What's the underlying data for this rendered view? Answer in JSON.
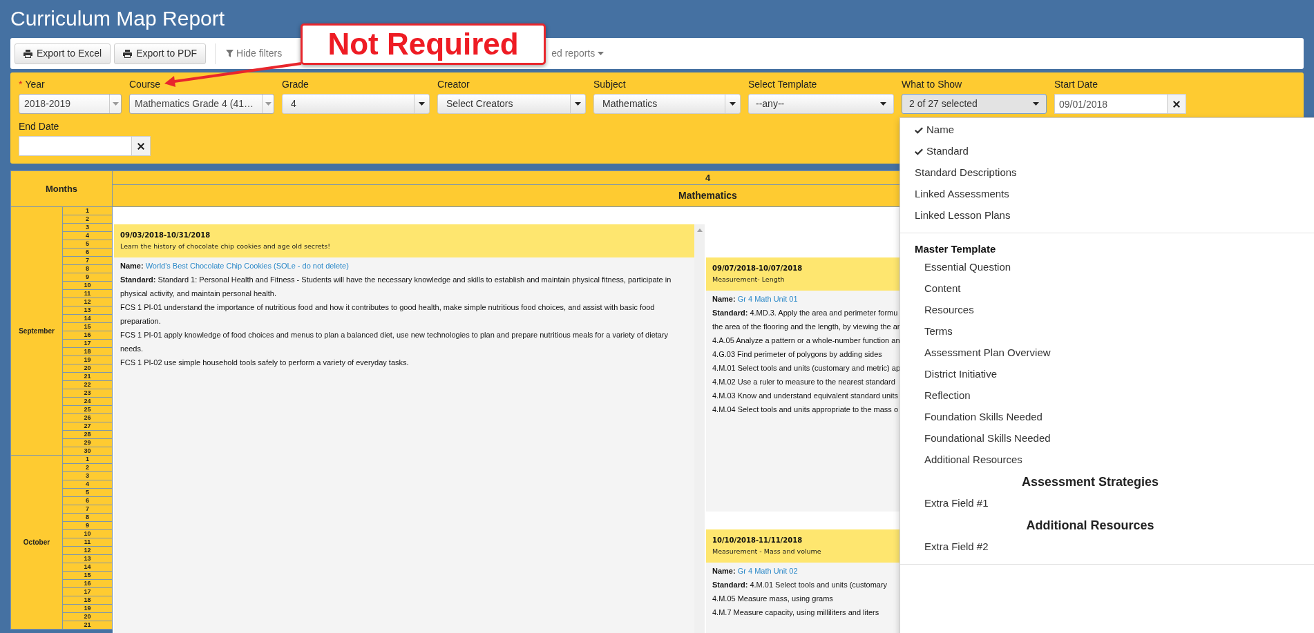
{
  "title": "Curriculum Map Report",
  "toolbar": {
    "buttons": [
      {
        "label": "Export to Excel"
      },
      {
        "label": "Export to PDF"
      }
    ],
    "links": [
      {
        "label": "Hide filters",
        "kind": "filter"
      },
      {
        "label": "ed reports",
        "kind": "menu"
      }
    ]
  },
  "annotation": {
    "text": "Not Required"
  },
  "filters": [
    {
      "label": "Year",
      "required_mark": "*",
      "kind": "combo",
      "value": "2018-2019"
    },
    {
      "label": "Course",
      "kind": "combo",
      "value": "Mathematics Grade 4 (41…"
    },
    {
      "label": "Grade",
      "kind": "select",
      "value": "4"
    },
    {
      "label": "Creator",
      "kind": "select",
      "value": "Select Creators"
    },
    {
      "label": "Subject",
      "kind": "select",
      "value": "Mathematics"
    },
    {
      "label": "Select Template",
      "kind": "plain",
      "value": "--any--",
      "open": false
    },
    {
      "label": "What to Show",
      "kind": "plain",
      "value": "2 of 27 selected",
      "open": true
    },
    {
      "label": "Start Date",
      "kind": "date",
      "value": "09/01/2018"
    },
    {
      "label": "End Date",
      "kind": "date"
    }
  ],
  "table": {
    "months_header": "Months",
    "grade_header": "4",
    "subject_header": "Mathematics",
    "months": [
      {
        "name": "September",
        "days": [
          "1",
          "2",
          "3",
          "4",
          "5",
          "6",
          "7",
          "8",
          "9",
          "10",
          "11",
          "12",
          "13",
          "14",
          "15",
          "16",
          "17",
          "18",
          "19",
          "20",
          "21",
          "22",
          "23",
          "24",
          "25",
          "26",
          "27",
          "28",
          "29",
          "30"
        ]
      },
      {
        "name": "October",
        "days": [
          "1",
          "2",
          "3",
          "4",
          "5",
          "6",
          "7",
          "8",
          "9",
          "10",
          "11",
          "12",
          "13",
          "14",
          "15",
          "16",
          "17",
          "18",
          "19",
          "20",
          "21"
        ]
      }
    ],
    "columns": [
      {
        "cards": [
          {
            "dates": "09/03/2018-10/31/2018",
            "description": "Learn the history of chocolate chip cookies and age old secrets!",
            "name_label": "Name:",
            "name": "World's Best Chocolate Chip Cookies (SOLe - do not delete)",
            "standard": "**Standard:** Standard 1: Personal Health and Fitness - Students will have the necessary knowledge and skills to establish and maintain physical fitness, participate in physical activity, and maintain personal health.",
            "lines": [
              "FCS 1 PI-01 understand the importance of nutritious food and how it contributes to good health, make simple nutritious food choices, and assist with basic food preparation.",
              "FCS 1 PI-01 apply knowledge of food choices and menus to plan a balanced diet, use new technologies to plan and prepare nutritious meals for a variety of dietary needs.",
              "FCS 1 PI-02 use simple household tools safely to perform a variety of everyday tasks."
            ]
          }
        ]
      },
      {
        "cards": [
          {
            "dates": "09/07/2018-10/07/2018",
            "description": "Measurement- Length",
            "name_label": "Name:",
            "name": "Gr 4 Math Unit 01",
            "standard": "**Standard:** 4.MD.3. Apply the area and perimeter formu",
            "lines": [
              "the area of the flooring and the length, by viewing the ar",
              "4.A.05 Analyze a pattern or a whole-number function an",
              "4.G.03 Find perimeter of polygons by adding sides",
              "4.M.01 Select tools and units (customary and metric) ap",
              "4.M.02 Use a ruler to measure to the nearest standard",
              "4.M.03 Know and understand equivalent standard units",
              "4.M.04 Select tools and units appropriate to the mass o"
            ]
          },
          {
            "dates": "10/10/2018-11/11/2018",
            "description": "Measurement - Mass and volume",
            "name_label": "Name:",
            "name": "Gr 4 Math Unit 02",
            "standard": "**Standard:** 4.M.01 Select tools and units (customary",
            "lines": [
              "4.M.05 Measure mass, using grams",
              "4.M.7 Measure capacity, using milliliters and liters"
            ]
          }
        ]
      }
    ]
  },
  "menu": {
    "items": [
      {
        "kind": "option",
        "label": "Name",
        "checked": true
      },
      {
        "kind": "option",
        "label": "Standard",
        "checked": true
      },
      {
        "kind": "option",
        "label": "Standard Descriptions",
        "checked": false
      },
      {
        "kind": "option",
        "label": "Linked Assessments",
        "checked": false
      },
      {
        "kind": "option",
        "label": "Linked Lesson Plans",
        "checked": false
      },
      {
        "kind": "divider"
      },
      {
        "kind": "group",
        "label": "Master Template"
      },
      {
        "kind": "sub",
        "label": "Essential Question",
        "checked": false
      },
      {
        "kind": "sub",
        "label": "Content",
        "checked": false
      },
      {
        "kind": "sub",
        "label": "Resources",
        "checked": false
      },
      {
        "kind": "sub",
        "label": "Terms",
        "checked": false
      },
      {
        "kind": "sub",
        "label": "Assessment Plan Overview",
        "checked": false
      },
      {
        "kind": "sub",
        "label": "District Initiative",
        "checked": false
      },
      {
        "kind": "sub",
        "label": "Reflection",
        "checked": false
      },
      {
        "kind": "sub",
        "label": "Foundation Skills Needed",
        "checked": false
      },
      {
        "kind": "sub",
        "label": "Foundational Skills Needed",
        "checked": false
      },
      {
        "kind": "sub",
        "label": "Additional Resources",
        "checked": false
      },
      {
        "kind": "heading",
        "label": "Assessment Strategies"
      },
      {
        "kind": "sub",
        "label": "Extra Field #1",
        "checked": false
      },
      {
        "kind": "heading",
        "label": "Additional Resources"
      },
      {
        "kind": "sub",
        "label": "Extra Field #2",
        "checked": false
      },
      {
        "kind": "divider"
      }
    ]
  }
}
